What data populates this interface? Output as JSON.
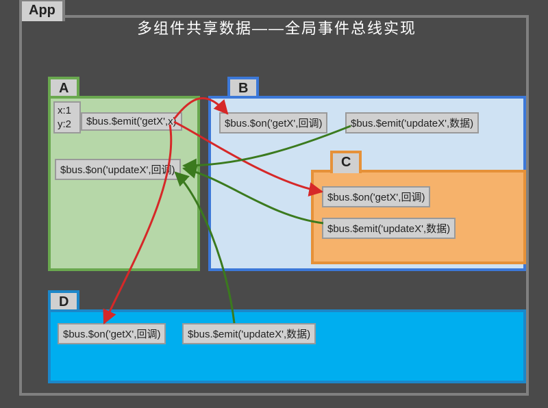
{
  "app": {
    "tab": "App",
    "title": "多组件共享数据——全局事件总线实现"
  },
  "A": {
    "label": "A",
    "xy1": "x:1",
    "xy2": "y:2",
    "emit": "$bus.$emit('getX',x)",
    "on": "$bus.$on('updateX',回调)"
  },
  "B": {
    "label": "B",
    "on": "$bus.$on('getX',回调)",
    "emit": "$bus.$emit('updateX',数据)"
  },
  "C": {
    "label": "C",
    "on": "$bus.$on('getX',回调)",
    "emit": "$bus.$emit('updateX',数据)"
  },
  "D": {
    "label": "D",
    "on": "$bus.$on('getX',回调)",
    "emit": "$bus.$emit('updateX',数据)"
  }
}
